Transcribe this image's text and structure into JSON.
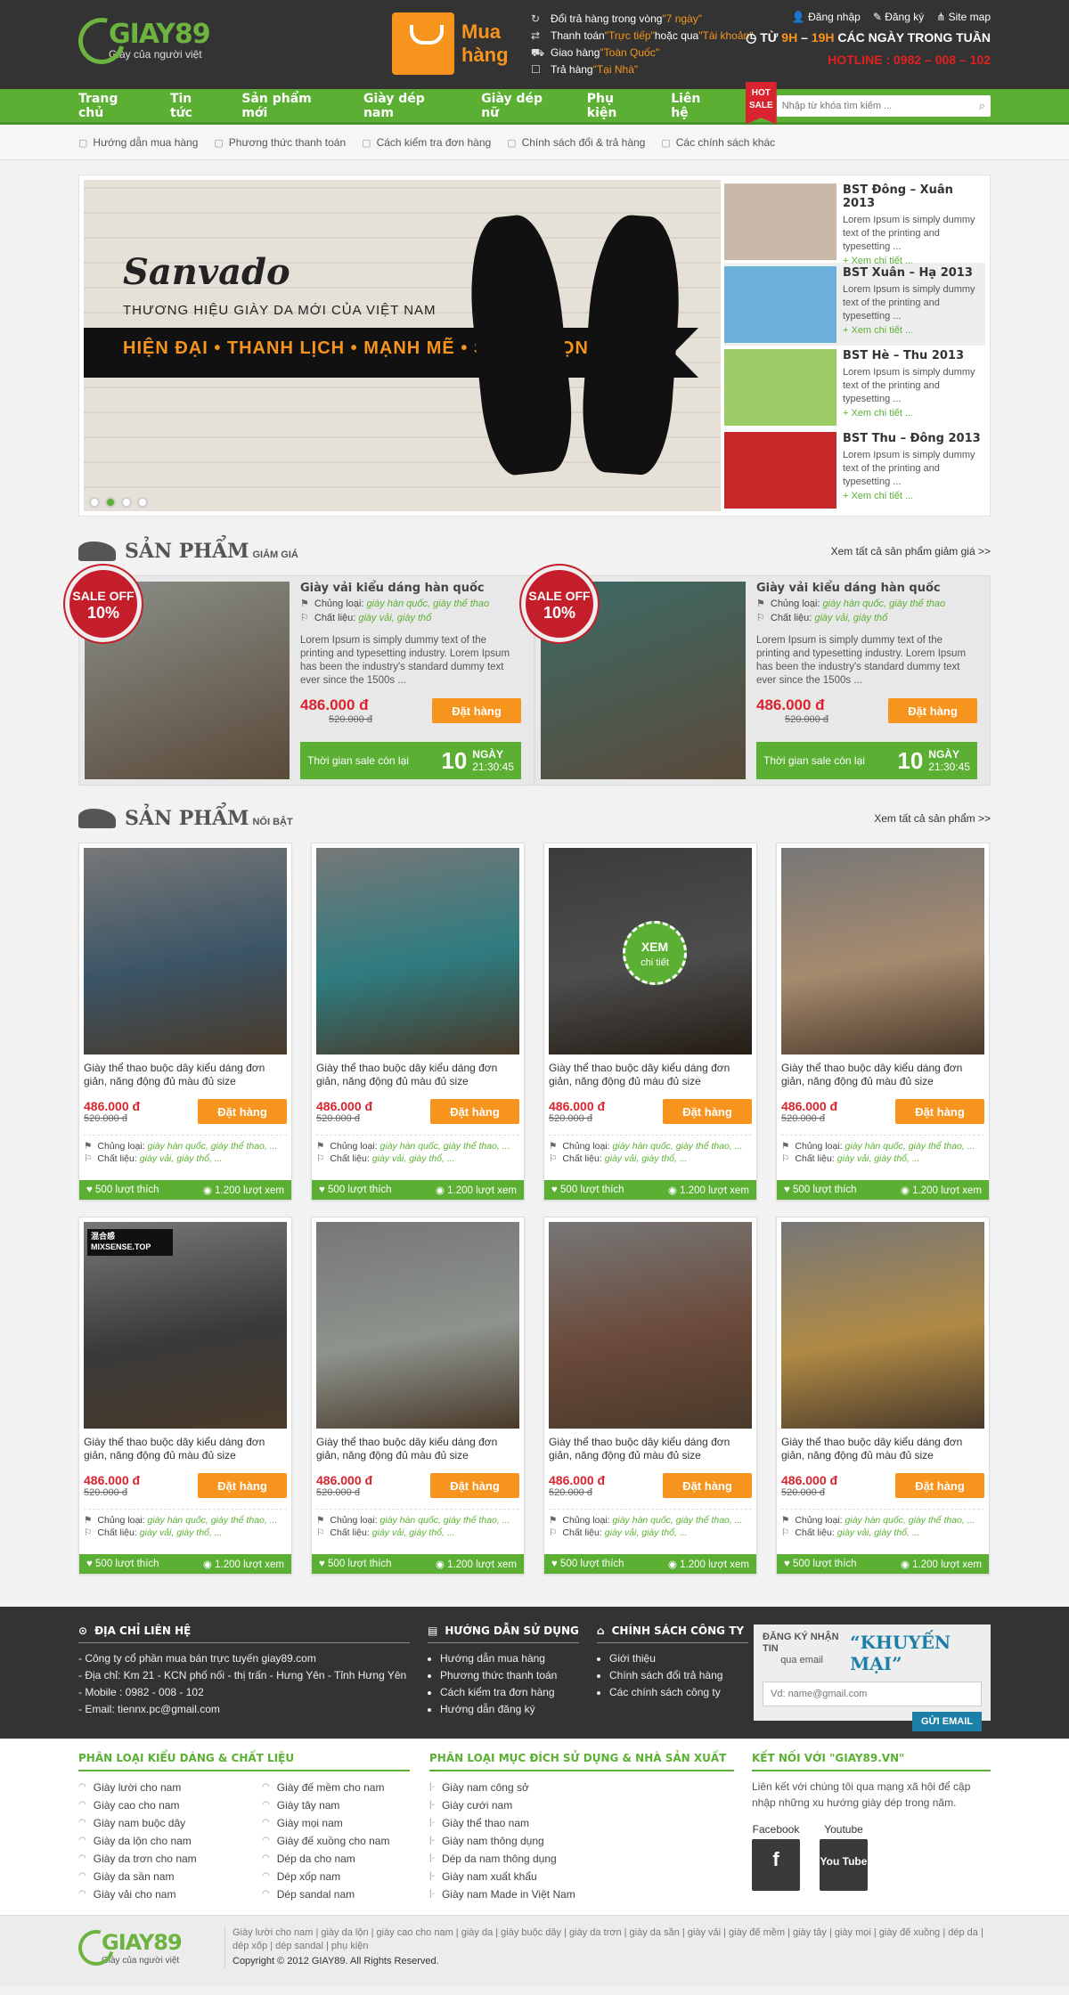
{
  "brand": {
    "name": "GIAY89",
    "slogan": "Giày của người việt"
  },
  "cart": {
    "label": "Mua hàng"
  },
  "services": [
    {
      "icon": "return-icon",
      "pre": "Đổi trả hàng trong vòng ",
      "hl": "\"7 ngày\"",
      "post": ""
    },
    {
      "icon": "payment-icon",
      "pre": "Thanh toán ",
      "hl": "\"Trực tiếp\"",
      "post": " hoặc qua ",
      "hl2": "\"Tài khoản\""
    },
    {
      "icon": "delivery-icon",
      "pre": "Giao hàng ",
      "hl": "\"Toàn Quốc\"",
      "post": ""
    },
    {
      "icon": "cash-icon",
      "pre": "Trả hàng ",
      "hl": "\"Tại Nhà\"",
      "post": ""
    }
  ],
  "account": {
    "login": "Đăng nhập",
    "register": "Đăng ký",
    "sitemap": "Site map",
    "hours_pre": "TỪ ",
    "hours_a": "9H",
    "hours_mid": " – ",
    "hours_b": "19H",
    "hours_post": " CÁC NGÀY TRONG TUẦN",
    "hotline": "HOTLINE : 0982 – 008 – 102"
  },
  "nav": {
    "items": [
      "Trang chủ",
      "Tin tức",
      "Sản phẩm mới",
      "Giày dép nam",
      "Giày dép nữ",
      "Phụ kiện",
      "Liên hệ"
    ],
    "hot": "HOT",
    "sale": "SALE",
    "search_placeholder": "Nhập từ khóa tìm kiếm ..."
  },
  "subnav": [
    "Hướng dẫn mua hàng",
    "Phương thức thanh toán",
    "Cách kiểm tra đơn hàng",
    "Chính sách đổi & trả hàng",
    "Các chính sách khác"
  ],
  "slider": {
    "brand": "Sanvado",
    "subtitle": "THƯƠNG HIỆU GIÀY DA MỚI CỦA VIỆT NAM",
    "tagline": "HIỆN ĐẠI • THANH LỊCH • MẠNH MẼ • SANG TRỌNG",
    "dots": 4,
    "active_dot": 2
  },
  "collections": [
    {
      "title": "BST Đông – Xuân 2013",
      "desc": "Lorem Ipsum is simply dummy text of the printing and typesetting ...",
      "more": "+ Xem chi tiết ...",
      "color": "#c9b9a8"
    },
    {
      "title": "BST Xuân – Hạ 2013",
      "desc": "Lorem Ipsum is simply dummy text of the printing and typesetting ...",
      "more": "+ Xem chi tiết ...",
      "color": "#6ab0d8"
    },
    {
      "title": "BST Hè – Thu 2013",
      "desc": "Lorem Ipsum is simply dummy text of the printing and typesetting ...",
      "more": "+ Xem chi tiết ...",
      "color": "#9ccc65"
    },
    {
      "title": "BST Thu – Đông 2013",
      "desc": "Lorem Ipsum is simply dummy text of the printing and typesetting ...",
      "more": "+ Xem chi tiết ...",
      "color": "#c62828"
    }
  ],
  "sale_section": {
    "title": "SẢN PHẨM",
    "sub": "GIẢM GIÁ",
    "link": "Xem tất cả sản phẩm giảm giá >>"
  },
  "sale_items": [
    {
      "badge_1": "SALE OFF",
      "badge_2": "10%",
      "title": "Giày vải kiểu dáng hàn quốc",
      "type_label": "Chủng loại:",
      "type_val": "giày hàn quốc, giày thể thao",
      "mat_label": "Chất liệu:",
      "mat_val": "giày vải, giày thổ",
      "desc": "Lorem Ipsum is simply dummy text of the printing and typesetting industry. Lorem Ipsum has been the industry's standard dummy text ever since the 1500s ...",
      "price": "486.000 đ",
      "old": "520.000 đ",
      "btn": "Đặt hàng",
      "cd_label": "Thời gian sale còn lại",
      "cd_num": "10",
      "cd_unit": "NGÀY",
      "cd_time": "21:30:45",
      "color": "#8a8f88"
    },
    {
      "badge_1": "SALE OFF",
      "badge_2": "10%",
      "title": "Giày vải kiểu dáng hàn quốc",
      "type_label": "Chủng loại:",
      "type_val": "giày hàn quốc, giày thể thao",
      "mat_label": "Chất liệu:",
      "mat_val": "giày vải, giày thổ",
      "desc": "Lorem Ipsum is simply dummy text of the printing and typesetting industry. Lorem Ipsum has been the industry's standard dummy text ever since the 1500s ...",
      "price": "486.000 đ",
      "old": "520.000 đ",
      "btn": "Đặt hàng",
      "cd_label": "Thời gian sale còn lại",
      "cd_num": "10",
      "cd_unit": "NGÀY",
      "cd_time": "21:30:45",
      "color": "#3d6b66"
    }
  ],
  "featured_section": {
    "title": "SẢN PHẨM",
    "sub": "NỔI BẬT",
    "link": "Xem tất cả sản phẩm >>"
  },
  "xem": {
    "big": "XEM",
    "small": "chi tiết"
  },
  "sticker": "混合感 MIXSENSE.TOP",
  "products": [
    {
      "name": "Giày thể thao buộc dây kiểu dáng đơn giản, năng động đủ màu đủ size",
      "price": "486.000 đ",
      "old": "520.000 đ",
      "btn": "Đặt hàng",
      "type_label": "Chủng loại:",
      "type_val": "giày hàn quốc, giày thể thao, ...",
      "mat_label": "Chất liệu:",
      "mat_val": "giày vải, giày thổ, ...",
      "likes": "500 lượt thích",
      "views": "1.200 lượt xem",
      "color": "#3b5566"
    },
    {
      "name": "Giày thể thao buộc dây kiểu dáng đơn giản, năng động đủ màu đủ size",
      "price": "486.000 đ",
      "old": "520.000 đ",
      "btn": "Đặt hàng",
      "type_label": "Chủng loại:",
      "type_val": "giày hàn quốc, giày thể thao, ...",
      "mat_label": "Chất liệu:",
      "mat_val": "giày vải, giày thổ, ...",
      "likes": "500 lượt thích",
      "views": "1.200 lượt xem",
      "color": "#2e7c80"
    },
    {
      "name": "Giày thể thao buộc dây kiểu dáng đơn giản, năng động đủ màu đủ size",
      "price": "486.000 đ",
      "old": "520.000 đ",
      "btn": "Đặt hàng",
      "type_label": "Chủng loại:",
      "type_val": "giày hàn quốc, giày thể thao, ...",
      "mat_label": "Chất liệu:",
      "mat_val": "giày vải, giày thổ, ...",
      "likes": "500 lượt thích",
      "views": "1.200 lượt xem",
      "color": "#9a9a9a",
      "hover": true
    },
    {
      "name": "Giày thể thao buộc dây kiểu dáng đơn giản, năng động đủ màu đủ size",
      "price": "486.000 đ",
      "old": "520.000 đ",
      "btn": "Đặt hàng",
      "type_label": "Chủng loại:",
      "type_val": "giày hàn quốc, giày thể thao, ...",
      "mat_label": "Chất liệu:",
      "mat_val": "giày vải, giày thổ, ...",
      "likes": "500 lượt thích",
      "views": "1.200 lượt xem",
      "color": "#a68a6e"
    },
    {
      "name": "Giày thể thao buộc dây kiểu dáng đơn giản, năng động đủ màu đủ size",
      "price": "486.000 đ",
      "old": "520.000 đ",
      "btn": "Đặt hàng",
      "type_label": "Chủng loại:",
      "type_val": "giày hàn quốc, giày thể thao, ...",
      "mat_label": "Chất liệu:",
      "mat_val": "giày vải, giày thổ, ...",
      "likes": "500 lượt thích",
      "views": "1.200 lượt xem",
      "color": "#3a3a3a",
      "sticker": true
    },
    {
      "name": "Giày thể thao buộc dây kiểu dáng đơn giản, năng động đủ màu đủ size",
      "price": "486.000 đ",
      "old": "520.000 đ",
      "btn": "Đặt hàng",
      "type_label": "Chủng loại:",
      "type_val": "giày hàn quốc, giày thể thao, ...",
      "mat_label": "Chất liệu:",
      "mat_val": "giày vải, giày thổ, ...",
      "likes": "500 lượt thích",
      "views": "1.200 lượt xem",
      "color": "#8d938d"
    },
    {
      "name": "Giày thể thao buộc dây kiểu dáng đơn giản, năng động đủ màu đủ size",
      "price": "486.000 đ",
      "old": "520.000 đ",
      "btn": "Đặt hàng",
      "type_label": "Chủng loại:",
      "type_val": "giày hàn quốc, giày thể thao, ...",
      "mat_label": "Chất liệu:",
      "mat_val": "giày vải, giày thổ, ...",
      "likes": "500 lượt thích",
      "views": "1.200 lượt xem",
      "color": "#6b4a3a"
    },
    {
      "name": "Giày thể thao buộc dây kiểu dáng đơn giản, năng động đủ màu đủ size",
      "price": "486.000 đ",
      "old": "520.000 đ",
      "btn": "Đặt hàng",
      "type_label": "Chủng loại:",
      "type_val": "giày hàn quốc, giày thể thao, ...",
      "mat_label": "Chất liệu:",
      "mat_val": "giày vải, giày thổ, ...",
      "likes": "500 lượt thích",
      "views": "1.200 lượt xem",
      "color": "#b08a45"
    }
  ],
  "footer": {
    "contact_title": "ĐỊA CHỈ LIÊN HỆ",
    "contact_lines": [
      "- Công ty cổ phần mua bán trực tuyến giay89.com",
      "- Địa chỉ: Km 21 - KCN phố nối - thị trấn - Hưng Yên - Tỉnh Hưng Yên",
      "- Mobile : 0982 - 008 - 102",
      "- Email: tiennx.pc@gmail.com"
    ],
    "guide_title": "HƯỚNG DẪN SỬ DỤNG",
    "guide_items": [
      "Hướng dẫn mua hàng",
      "Phương thức thanh toán",
      "Cách kiểm tra đơn hàng",
      "Hướng dẫn đăng ký"
    ],
    "policy_title": "CHÍNH SÁCH CÔNG TY",
    "policy_items": [
      "Giới thiệu",
      "Chính sách đổi trả hàng",
      "Các chính sách công ty"
    ],
    "nl_label": "ĐĂNG KÝ NHẬN TIN",
    "nl_sub": "qua email",
    "nl_promo": "KHUYẾN MẠI",
    "nl_placeholder": "Vd: name@gmail.com",
    "nl_btn": "GỬI EMAIL",
    "cat_title": "PHÂN LOẠI KIỂU DÁNG & CHẤT LIỆU",
    "cat_col1": [
      "Giày lười cho nam",
      "Giày cao cho nam",
      "Giày nam buộc dây",
      "Giày da lộn cho nam",
      "Giày da trơn cho nam",
      "Giày da sần nam",
      "Giày vải cho nam"
    ],
    "cat_col2": [
      "Giày đế mềm cho nam",
      "Giày tây nam",
      "Giày mọi nam",
      "Giày đế xuồng cho nam",
      "Dép da cho nam",
      "Dép xốp nam",
      "Dép sandal nam"
    ],
    "use_title": "PHÂN LOẠI MỤC ĐÍCH SỬ DỤNG & NHÀ SẢN XUẤT",
    "use_items": [
      "Giày nam công sở",
      "Giày cưới nam",
      "Giày thể thao nam",
      "Giày nam thông dụng",
      "Dép da nam thông dụng",
      "Giày nam xuất khẩu",
      "Giày nam Made in Việt Nam"
    ],
    "connect_title": "KẾT NỐI VỚI \"GIAY89.VN\"",
    "connect_desc": "Liên kết với chúng tôi qua mạng xã hội để cập nhập những xu hướng giày dép trong năm.",
    "fb_label": "Facebook",
    "yt_label": "Youtube",
    "fb_glyph": "f",
    "yt_glyph": "You Tube",
    "tags": "Giày lười cho nam | giày da lộn | giày cao cho nam | giày da | giày buộc dây | giày da trơn | giày da sần | giày vải | giày đế mềm | giày tây | giày mọi | giày đế xuồng | dép da | dép xốp | dép sandal | phụ kiện",
    "copyright": "Copyright © 2012 GIAY89. All Rights Reserved."
  },
  "colors": {
    "green": "#5bb033",
    "orange": "#f7941d",
    "red": "#d9232e",
    "dark": "#333333"
  }
}
